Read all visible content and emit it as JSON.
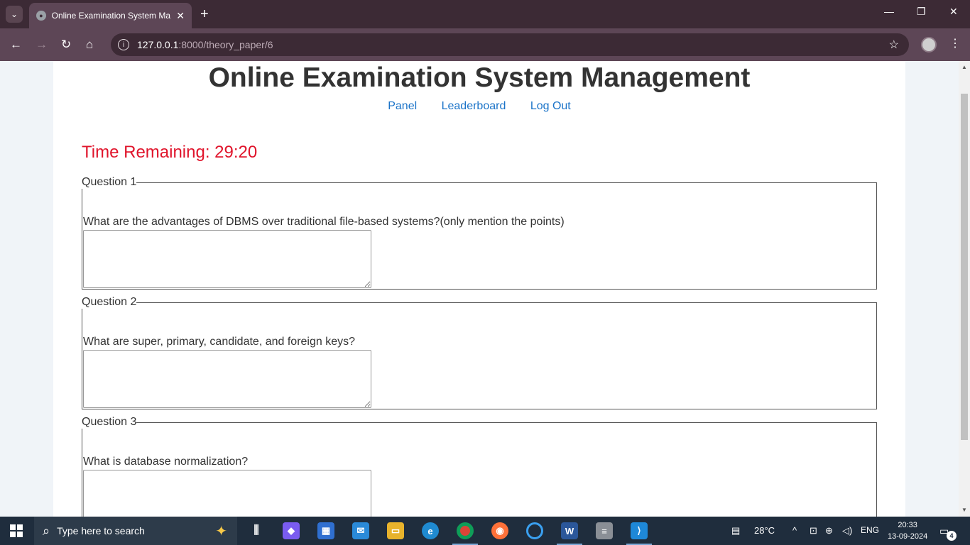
{
  "browser": {
    "tab_title": "Online Examination System Ma",
    "url_host": "127.0.0.1",
    "url_path": ":8000/theory_paper/6",
    "new_tab_label": "+",
    "close_tab_label": "✕"
  },
  "page": {
    "title": "Online Examination System Management",
    "nav": [
      {
        "label": "Panel"
      },
      {
        "label": "Leaderboard"
      },
      {
        "label": "Log Out"
      }
    ],
    "timer": "Time Remaining: 29:20",
    "questions": [
      {
        "legend": "Question 1",
        "text": "What are the advantages of DBMS over traditional file-based systems?(only mention the points)",
        "answer": ""
      },
      {
        "legend": "Question 2",
        "text": "What are super, primary, candidate, and foreign keys?",
        "answer": ""
      },
      {
        "legend": "Question 3",
        "text": "What is database normalization?",
        "answer": ""
      }
    ]
  },
  "taskbar": {
    "search_placeholder": "Type here to search",
    "weather": "28°C",
    "language": "ENG",
    "time": "20:33",
    "date": "13-09-2024",
    "notification_count": "4",
    "apps": [
      "task-view",
      "copilot",
      "microsoft-store",
      "mail",
      "file-explorer",
      "edge",
      "chrome",
      "firefox",
      "cortana",
      "word",
      "database",
      "vscode"
    ]
  },
  "colors": {
    "timer": "#e0142b",
    "link": "#1a73c8",
    "chrome_frame": "#3c2a35",
    "chrome_toolbar": "#5d4656",
    "taskbar": "#1f2d3d"
  }
}
